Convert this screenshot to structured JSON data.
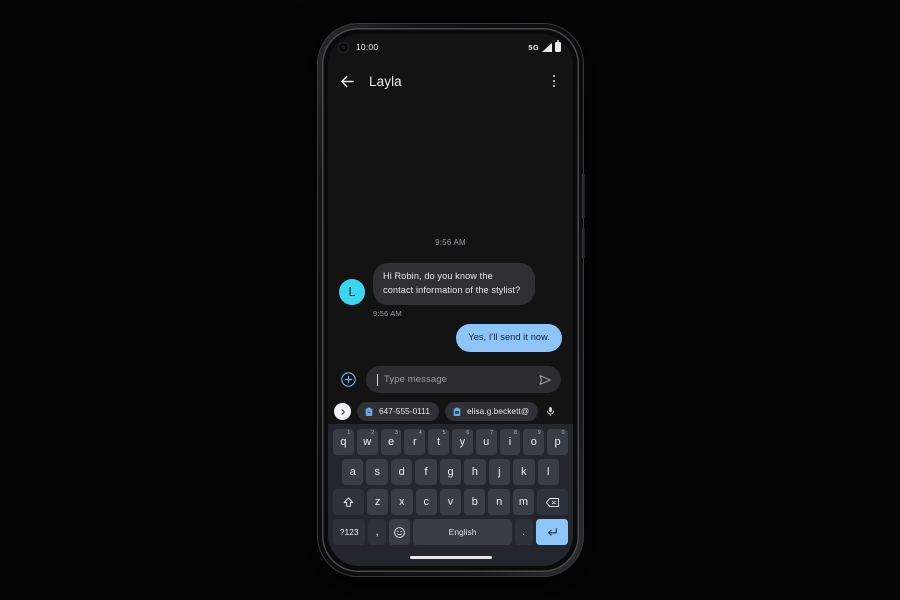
{
  "status_bar": {
    "time": "10:00",
    "network": "5G",
    "camera_icon": "front-camera-punch-hole",
    "signal_icon": "signal-bars-icon",
    "battery_icon": "battery-full-icon"
  },
  "app_bar": {
    "back_icon": "back-arrow-icon",
    "title": "Layla",
    "overflow_icon": "more-options-icon"
  },
  "conversation": {
    "day_timestamp": "9:56 AM",
    "messages": [
      {
        "direction": "incoming",
        "avatar_initial": "L",
        "text": "Hi Robin, do you know the contact information of the stylist?",
        "timestamp": "9:56 AM"
      },
      {
        "direction": "outgoing",
        "text": "Yes, I'll send it now."
      }
    ]
  },
  "compose": {
    "attach_icon": "add-circle-icon",
    "placeholder": "Type message",
    "value": "",
    "send_icon": "send-icon"
  },
  "suggestions": {
    "expand_icon": "chevron-right-icon",
    "chips": [
      {
        "icon": "clipboard-phone-icon",
        "label": "647-555-0111"
      },
      {
        "icon": "clipboard-mail-icon",
        "label": "elisa.g.beckett@"
      }
    ],
    "mic_icon": "microphone-icon"
  },
  "keyboard": {
    "row1": [
      {
        "key": "q",
        "num": "1"
      },
      {
        "key": "w",
        "num": "2"
      },
      {
        "key": "e",
        "num": "3"
      },
      {
        "key": "r",
        "num": "4"
      },
      {
        "key": "t",
        "num": "5"
      },
      {
        "key": "y",
        "num": "6"
      },
      {
        "key": "u",
        "num": "7"
      },
      {
        "key": "i",
        "num": "8"
      },
      {
        "key": "o",
        "num": "9"
      },
      {
        "key": "p",
        "num": "0"
      }
    ],
    "row2": [
      "a",
      "s",
      "d",
      "f",
      "g",
      "h",
      "j",
      "k",
      "l"
    ],
    "row3": [
      "z",
      "x",
      "c",
      "v",
      "b",
      "n",
      "m"
    ],
    "shift_icon": "shift-icon",
    "backspace_icon": "backspace-icon",
    "symbols_label": "?123",
    "comma_label": ",",
    "emoji_icon": "emoji-icon",
    "space_label": "English",
    "period_label": ".",
    "enter_icon": "enter-key-icon"
  },
  "system": {
    "gesture_bar": "home-gesture-bar"
  },
  "colors": {
    "accent_blue": "#8ec5f9",
    "avatar_cyan": "#3ad6ef",
    "screen_bg": "#131314",
    "keyboard_bg": "#23262d",
    "key_bg": "#393d46"
  }
}
